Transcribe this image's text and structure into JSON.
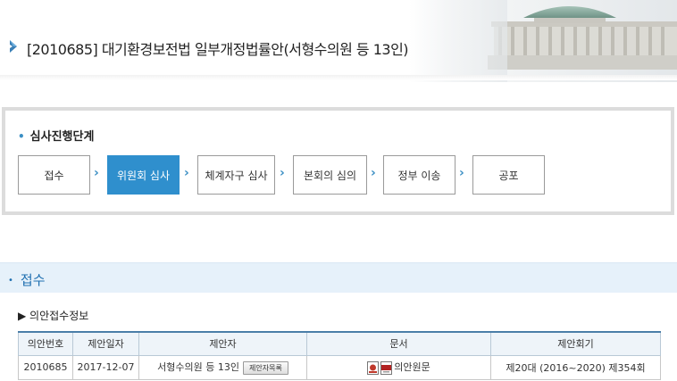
{
  "header": {
    "bill_title": "[2010685] 대기환경보전법 일부개정법률안(서형수의원 등 13인)"
  },
  "stages": {
    "heading": "심사진행단계",
    "steps": [
      {
        "label": "접수",
        "active": false
      },
      {
        "label": "위원회 심사",
        "active": true
      },
      {
        "label": "체계자구 심사",
        "active": false
      },
      {
        "label": "본회의 심의",
        "active": false
      },
      {
        "label": "정부 이송",
        "active": false
      },
      {
        "label": "공포",
        "active": false
      }
    ],
    "arrow": "›"
  },
  "section": {
    "title": "접수",
    "sub_heading": "▶ 의안접수정보"
  },
  "table": {
    "headers": [
      "의안번호",
      "제안일자",
      "제안자",
      "문서",
      "제안회기"
    ],
    "row": {
      "bill_no": "2010685",
      "date": "2017-12-07",
      "proposer": "서형수의원 등 13인",
      "proposer_button": "제안자목록",
      "document": "의안원문",
      "session": "제20대 (2016~2020) 제354회"
    }
  },
  "colors": {
    "accent": "#2f8fcd",
    "section_bg": "#e6f1fa",
    "section_text": "#1e6fb0"
  }
}
